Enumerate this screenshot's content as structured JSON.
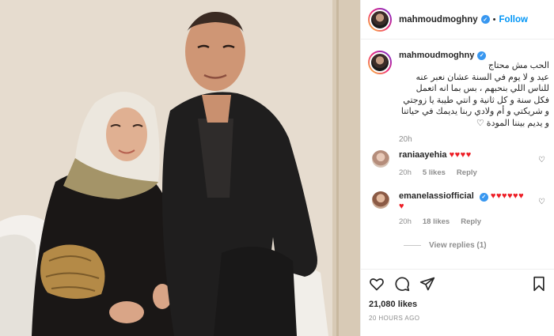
{
  "header": {
    "username": "mahmoudmoghny",
    "separator": "•",
    "follow_label": "Follow"
  },
  "caption": {
    "username": "mahmoudmoghny",
    "text": "الحب مش محتاج\nعيد و لا يوم في السنة عشان نعبر عنه\nللناس اللي بنحبهم ، بس بما انه اتعمل\nفكل سنة و كل ثانية و انتي طيبة يا زوجتي\nو شريكتي و أم ولادي ربنا يديمك في حياتنا\nو يديم بيننا المودة ♡",
    "time": "20h"
  },
  "comments": [
    {
      "username": "raniaayehia",
      "hearts": "♥♥♥♥",
      "time": "20h",
      "likes": "5 likes",
      "reply": "Reply"
    },
    {
      "username": "emanelassiofficial",
      "hearts_line1": "♥♥♥♥♥♥",
      "hearts_line2": "♥",
      "time": "20h",
      "likes": "18 likes",
      "reply": "Reply"
    }
  ],
  "view_replies": "View replies (1)",
  "footer": {
    "likes": "21,080 likes",
    "posted": "20 HOURS AGO"
  },
  "icons": {
    "like": "heart-outline-icon",
    "comment": "comment-icon",
    "share": "share-icon",
    "save": "bookmark-icon",
    "verified": "verified-badge-icon"
  },
  "colors": {
    "accent": "#0095f6",
    "verified": "#3897f0",
    "heart_emoji": "#ed1c24",
    "muted": "#8e8e8e"
  }
}
